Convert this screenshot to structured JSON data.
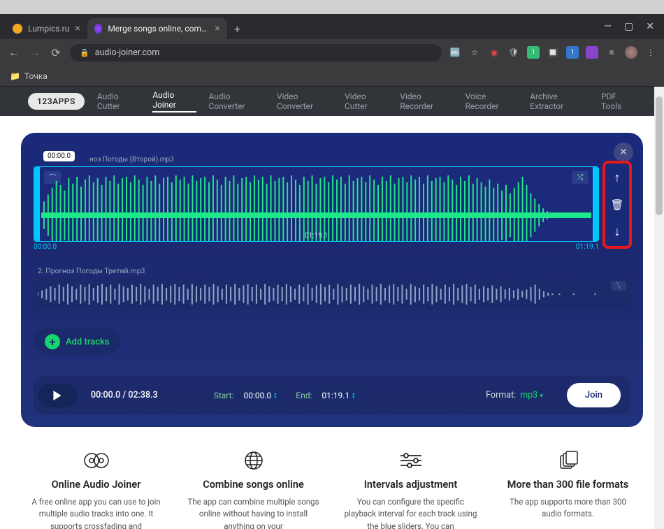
{
  "browser": {
    "tabs": [
      {
        "favicon_color": "#f5a623",
        "title": "Lumpics.ru",
        "active": false
      },
      {
        "favicon_color": "#8a3cff",
        "title": "Merge songs online, combine mp",
        "active": true
      }
    ],
    "url_host": "audio-joiner.com",
    "bookmark": "Точка"
  },
  "nav": {
    "logo": "123APPS",
    "items": [
      "Audio Cutter",
      "Audio Joiner",
      "Audio Converter",
      "Video Converter",
      "Video Cutter",
      "Video Recorder",
      "Voice Recorder",
      "Archive Extractor",
      "PDF Tools"
    ],
    "active_index": 1
  },
  "editor": {
    "time_badge": "00:00.0",
    "track1_filename": "ноз Погоды (Второй).mp3",
    "track1_duration_center": "01:19.1",
    "timeline_left": "00:00.0",
    "timeline_right": "01:19.1",
    "track2_label": "2. Прогноз Погоды Третий.mp3",
    "add_tracks": "Add tracks",
    "counter": "00:00.0 / 02:38.3",
    "start_label": "Start:",
    "start_value": "00:00.0",
    "end_label": "End:",
    "end_value": "01:19.1",
    "format_label": "Format:",
    "format_value": "mp3",
    "join_label": "Join"
  },
  "features": [
    {
      "title": "Online Audio Joiner",
      "desc": "A free online app you can use to join multiple audio tracks into one. It supports crossfading and"
    },
    {
      "title": "Combine songs online",
      "desc": "The app can combine multiple songs online without having to install anything on your"
    },
    {
      "title": "Intervals adjustment",
      "desc": "You can configure the specific playback interval for each track using the blue sliders. You can"
    },
    {
      "title": "More than 300 file formats",
      "desc": "The app supports more than 300 audio formats."
    }
  ]
}
